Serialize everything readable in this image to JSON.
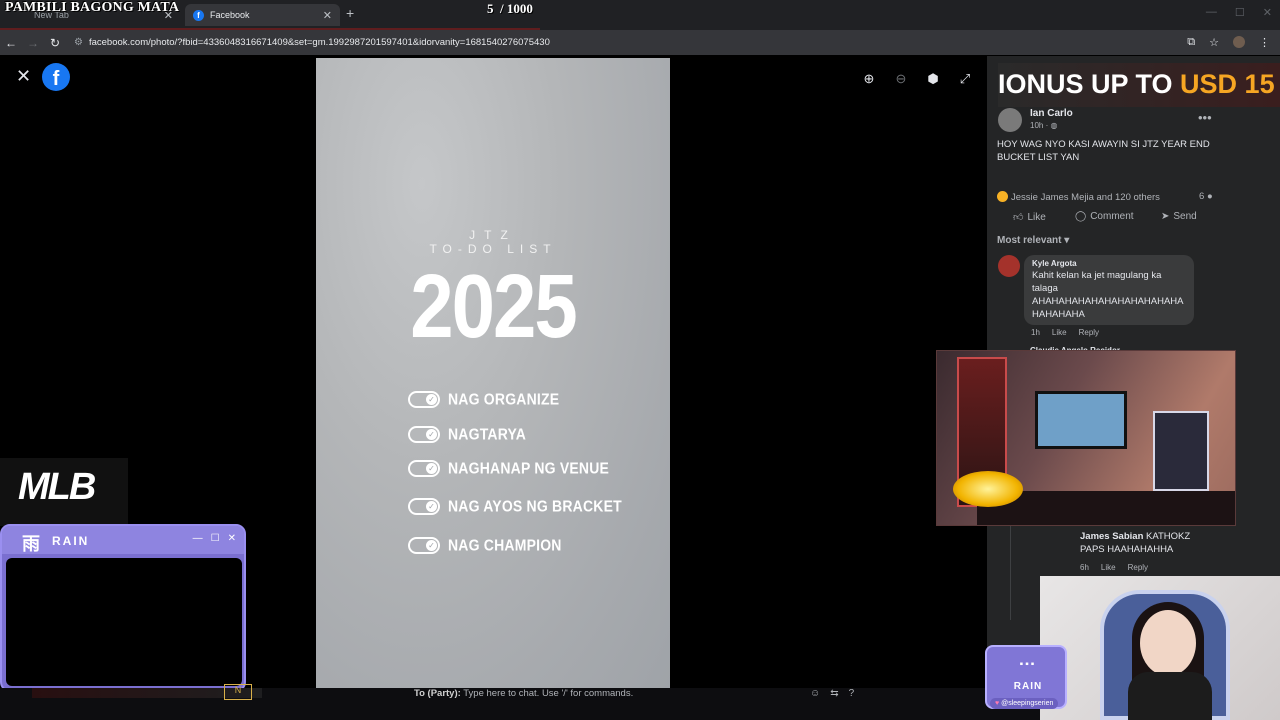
{
  "browser": {
    "tabs": [
      {
        "label": "New Tab",
        "active": false
      },
      {
        "label": "Facebook",
        "active": true
      }
    ],
    "url": "facebook.com/photo/?fbid=4336048316671409&set=gm.1992987201597401&idorvanity=1681540276075430"
  },
  "stream_overlay": {
    "title": "PAMBILI BAGONG MATA",
    "counter": "5",
    "counter_total": "/ 1000"
  },
  "photo": {
    "brand": "JTZ",
    "subtitle": "TO-DO LIST",
    "year": "2025",
    "items": [
      {
        "label": "NAG ORGANIZE",
        "checked": true
      },
      {
        "label": "NAGTARYA",
        "checked": true
      },
      {
        "label": "NAGHANAP NG VENUE",
        "checked": true
      },
      {
        "label": "NAG AYOS NG BRACKET",
        "checked": true
      },
      {
        "label": "NAG CHAMPION",
        "checked": true
      }
    ]
  },
  "panel": {
    "promo_text": "IONUS UP TO ",
    "promo_highlight": "USD 15",
    "poster": {
      "name": "Ian Carlo",
      "time": "10h ·"
    },
    "post_text": "HOY WAG NYO KASI AWAYIN SI JTZ YEAR END BUCKET LIST YAN",
    "reactions_text": "Jessie James Mejia and 120 others",
    "comment_count": "6",
    "actions": {
      "like": "Like",
      "comment": "Comment",
      "send": "Send"
    },
    "sort_label": "Most relevant",
    "comments": [
      {
        "name": "Kyle Argota",
        "text": "Kahit kelan ka jet magulang ka talaga AHAHAHAHAHAHAHAHAHAHAHA HAHAHAHA",
        "time": "1h",
        "like": "Like",
        "reply": "Reply"
      },
      {
        "name": "Claudie Angelo Recidor"
      },
      {
        "name": "James Sabian",
        "text": "KATHOKZ PAPS HAAHAHAHHA",
        "time": "6h",
        "like": "Like",
        "reply": "Reply"
      }
    ]
  },
  "chat": {
    "prefix": "To (Party):",
    "placeholder": "Type here to chat. Use '/' for commands."
  },
  "widgets": {
    "mlb_logo": "MLB",
    "rain_logo": "RAIN",
    "rain_kanji": "雨",
    "handle": "@sleepingserien",
    "hud_badge": "N"
  },
  "colors": {
    "facebook_blue": "#1877f2",
    "panel_bg": "#242526",
    "rain_purple": "#8076d6"
  }
}
